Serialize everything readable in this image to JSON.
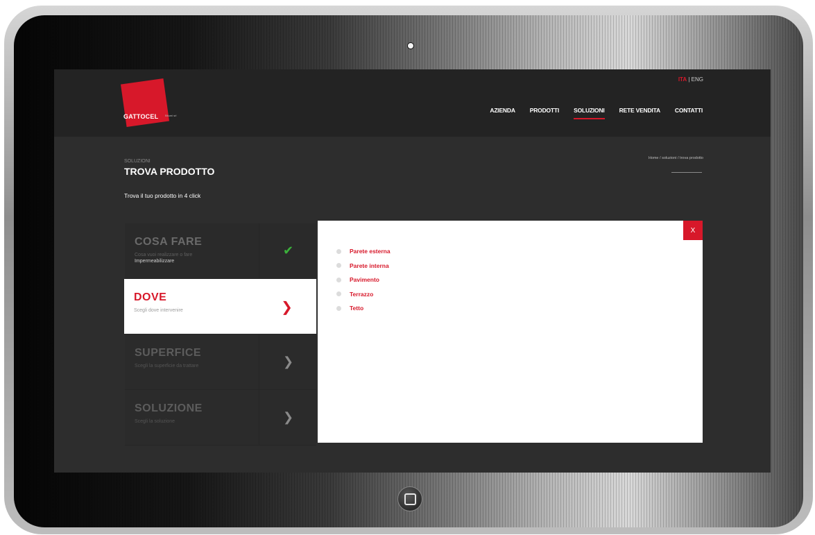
{
  "site": {
    "logo_text": "GATTOCEL",
    "logo_tagline": "Bitumi srl",
    "lang": {
      "ita": "ITA",
      "sep": " | ",
      "eng": "ENG"
    },
    "nav": [
      "AZIENDA",
      "PRODOTTI",
      "SOLUZIONI",
      "RETE VENDITA",
      "CONTATTI"
    ],
    "nav_active": "SOLUZIONI"
  },
  "page": {
    "section": "SOLUZIONI",
    "title": "TROVA PRODOTTO",
    "subtitle": "Trova il tuo prodotto in 4 click",
    "breadcrumb": "Home  /  soluzioni  /  trova prodotto"
  },
  "steps": [
    {
      "title": "COSA FARE",
      "desc": "Cosa vuoi realizzare o fare",
      "value": "Impermeabilizzare",
      "state": "done",
      "icon": "check-icon"
    },
    {
      "title": "DOVE",
      "desc": "Scegli dove intervenire",
      "state": "current",
      "icon": "chevron-right-icon"
    },
    {
      "title": "SUPERFICE",
      "desc": "Scegli la superficie da trattare",
      "state": "pending",
      "icon": "chevron-right-icon"
    },
    {
      "title": "SOLUZIONE",
      "desc": "Scegli la soluzione",
      "state": "pending",
      "icon": "chevron-right-icon"
    }
  ],
  "panel": {
    "close_label": "X",
    "options": [
      "Parete esterna",
      "Parete interna",
      "Pavimento",
      "Terrazzo",
      "Tetto"
    ]
  },
  "colors": {
    "accent": "#d7182a",
    "screen_bg": "#2d2d2d",
    "topbar_bg": "#232323",
    "check": "#3bb13b"
  }
}
